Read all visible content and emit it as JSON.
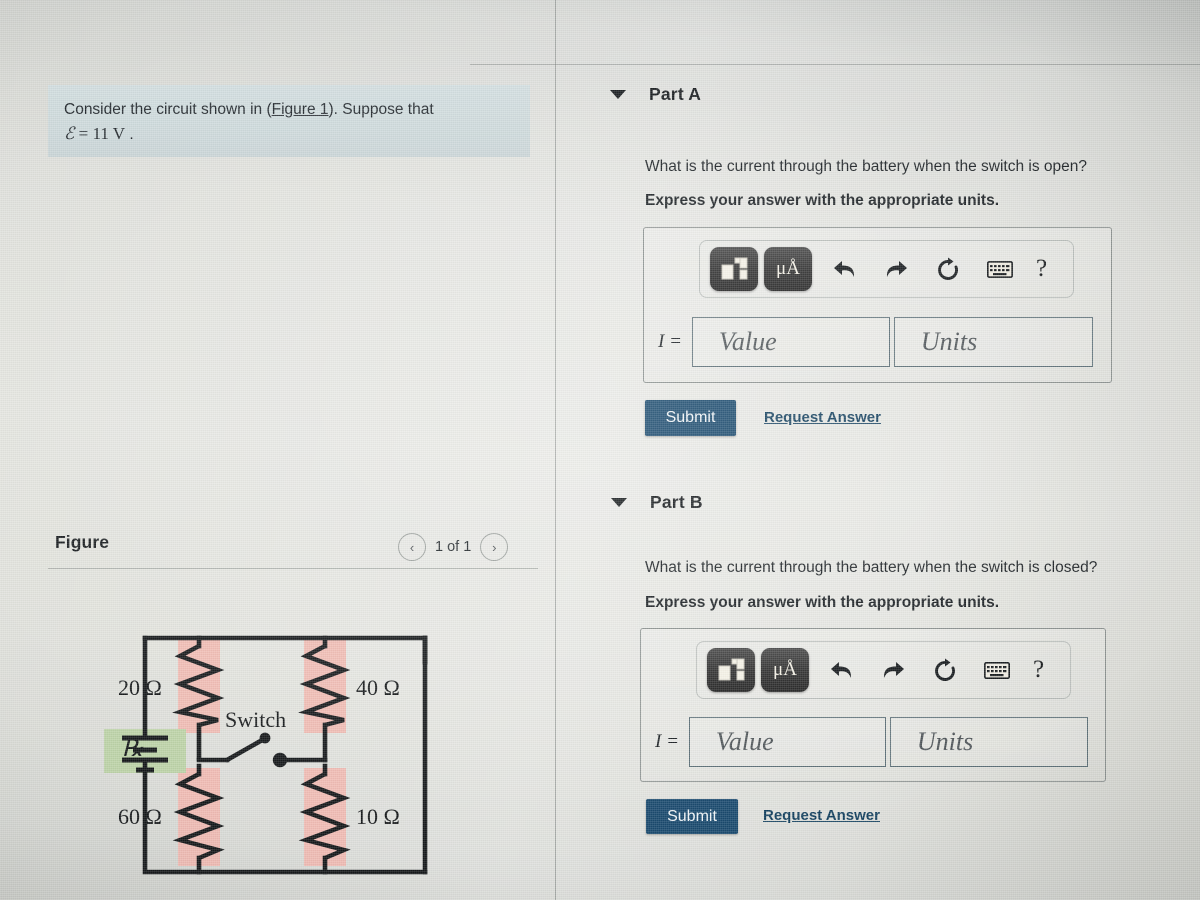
{
  "question": {
    "text_before_link": "Consider the circuit shown in (",
    "figure_link": "Figure 1",
    "text_after_link": "). Suppose that",
    "emf_symbol": "ℰ",
    "emf_equation": "= 11 V",
    "emf_period": "."
  },
  "figure": {
    "title": "Figure",
    "prev_label": "‹",
    "next_label": "›",
    "page_count": "1 of 1",
    "circuit": {
      "battery_symbol": "ℰ",
      "switch_label": "Switch",
      "resistors": [
        {
          "label": "20 Ω",
          "position": "top-left"
        },
        {
          "label": "40 Ω",
          "position": "top-right"
        },
        {
          "label": "60 Ω",
          "position": "bottom-left"
        },
        {
          "label": "10 Ω",
          "position": "bottom-right"
        }
      ],
      "resistor_highlight_color": "#f0bcb4",
      "battery_highlight_color": "#bdd3a8"
    }
  },
  "parts": [
    {
      "id": "part-a",
      "title": "Part A",
      "question": "What is the current through the battery when the switch is open?",
      "instruction": "Express your answer with the appropriate units.",
      "variable_label": "I =",
      "value_placeholder": "Value",
      "units_placeholder": "Units",
      "submit_label": "Submit",
      "request_answer_label": "Request Answer"
    },
    {
      "id": "part-b",
      "title": "Part B",
      "question": "What is the current through the battery when the switch is closed?",
      "instruction": "Express your answer with the appropriate units.",
      "variable_label": "I =",
      "value_placeholder": "Value",
      "units_placeholder": "Units",
      "submit_label": "Submit",
      "request_answer_label": "Request Answer"
    }
  ],
  "toolbar": {
    "template_icon": "math-template-icon",
    "units_icon": "μÅ",
    "undo_icon": "undo-icon",
    "redo_icon": "redo-icon",
    "reset_icon": "reset-icon",
    "keyboard_icon": "keyboard-icon",
    "help_icon": "?"
  },
  "colors": {
    "submit_button": "#1a4a6e",
    "link": "#123f5e",
    "question_box": "#cdd9db"
  }
}
